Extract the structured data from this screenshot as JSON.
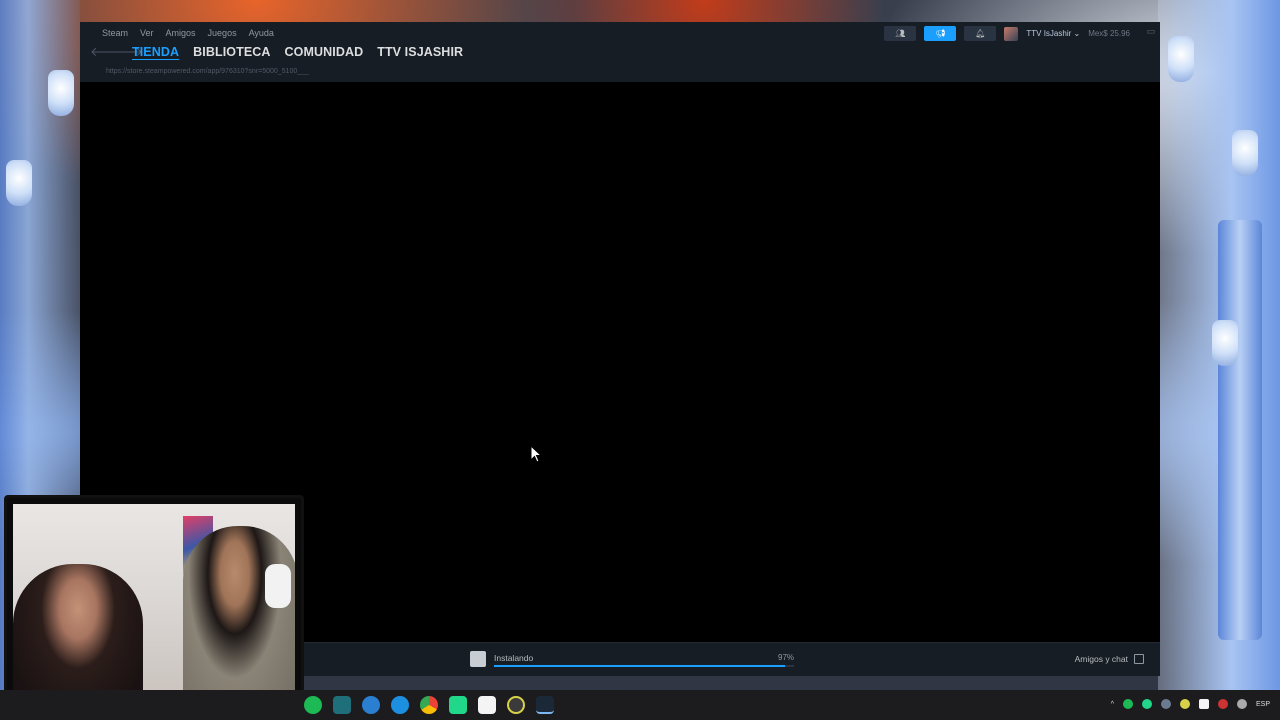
{
  "steam": {
    "menu": [
      "Steam",
      "Ver",
      "Amigos",
      "Juegos",
      "Ayuda"
    ],
    "nav_back": "🡐",
    "nav_forward": "🡒",
    "tabs": [
      {
        "label": "TIENDA",
        "active": true
      },
      {
        "label": "BIBLIOTECA",
        "active": false
      },
      {
        "label": "COMUNIDAD",
        "active": false
      },
      {
        "label": "TTV ISJASHIR",
        "active": false
      }
    ],
    "url": "https://store.steampowered.com/app/976310?snr=5000_5100___",
    "user": {
      "name": "TTV IsJashir ⌄",
      "balance": "Mex$ 25.96"
    },
    "download": {
      "status": "Instalando",
      "percent_label": "97%",
      "progress": 0.97
    },
    "friends_chat": "Amigos y chat"
  },
  "taskbar": {
    "language": "ESP",
    "apps": [
      "spotify",
      "edge-dev",
      "opera",
      "edge",
      "chrome",
      "pycharm",
      "capcut",
      "obs",
      "steam"
    ]
  },
  "colors": {
    "steam_blue": "#1a9fff",
    "steam_bar": "#171d25"
  }
}
